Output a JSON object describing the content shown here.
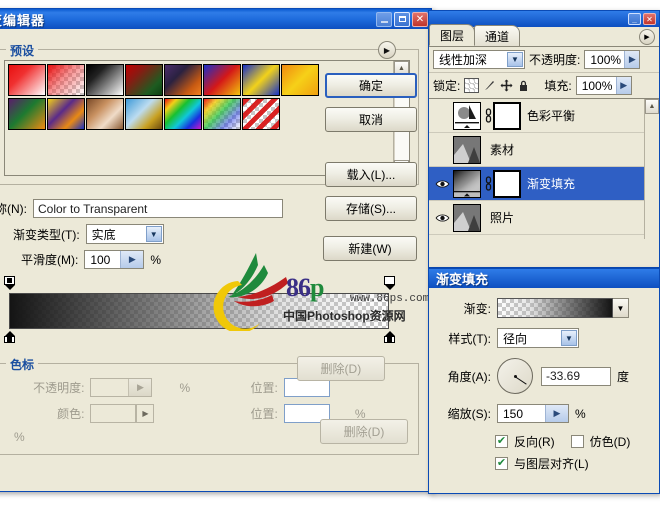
{
  "gradient_editor": {
    "title": "变编辑器",
    "window_buttons": {
      "minimize": "_",
      "maximize": "□",
      "close": "✕"
    },
    "presets_group_label": "预设",
    "presets_menu_icon": "play-arrow-icon",
    "buttons": {
      "ok": "确定",
      "cancel": "取消",
      "load": "载入(L)...",
      "save": "存储(S)...",
      "new": "新建(W)"
    },
    "name_label": "称(N):",
    "name_value": "Color to Transparent",
    "gradient_type_label": "渐变类型(T):",
    "gradient_type_value": "实底",
    "smoothness_label": "平滑度(M):",
    "smoothness_value": "100",
    "smoothness_unit": "%",
    "stops_group_label": "色标",
    "opacity_label": "不透明度:",
    "opacity_value": "",
    "opacity_unit": "%",
    "color_label": "颜色:",
    "location_label_1": "位置:",
    "location_value_1": "",
    "location_unit_1": "%",
    "location_label_2": "位置:",
    "location_value_2": "",
    "location_unit_2": "%",
    "delete_label_1": "删除(D)",
    "delete_label_2": "删除(D)"
  },
  "presets": [
    {
      "name": "foreground-to-background",
      "css": "linear-gradient(135deg,#e81010 0%,#f03030 35%,#ffffff 100%)"
    },
    {
      "name": "foreground-to-transparent",
      "css": "linear-gradient(135deg,rgba(232,16,16,1) 0%,rgba(240,60,60,.55) 45%,rgba(255,255,255,0) 100%)",
      "checker": true
    },
    {
      "name": "black-white",
      "css": "linear-gradient(135deg,#000000 0%,#222222 30%,#ffffff 100%)"
    },
    {
      "name": "red-green",
      "css": "linear-gradient(135deg,#c00000 0%,#8a1a12 30%,#1d5c20 75%,#0d3f12 100%)"
    },
    {
      "name": "violet-orange",
      "css": "linear-gradient(135deg,#4b2d6b 0%,#2a2140 35%,#c85a12 75%,#f08020 100%)"
    },
    {
      "name": "blue-red-yellow",
      "css": "linear-gradient(135deg,#1b2ec8 0%,#d41818 50%,#f2c40c 100%)"
    },
    {
      "name": "blue-yellow-blue",
      "css": "linear-gradient(135deg,#1630c8 0%,#f2d21a 50%,#1630c8 100%)"
    },
    {
      "name": "orange-yellow-orange",
      "css": "linear-gradient(135deg,#f08a10 0%,#f6d018 50%,#f0a010 100%)"
    },
    {
      "name": "violet-green-orange",
      "css": "linear-gradient(135deg,#5a1d6b 0%,#1d7a30 45%,#f08a12 100%)"
    },
    {
      "name": "yellow-violet-orange-blue",
      "css": "linear-gradient(135deg,#f2cf18 0%,#5a2a8a 40%,#e88a14 70%,#1830c0 100%)"
    },
    {
      "name": "copper",
      "css": "linear-gradient(135deg,#7a4a28 0%,#c89060 35%,#f0dcc8 65%,#8a5a32 100%)"
    },
    {
      "name": "chrome",
      "css": "linear-gradient(135deg,#3e9ad8 0%,#bcdcf0 42%,#c8a020 72%,#6a4a10 100%)"
    },
    {
      "name": "spectrum",
      "css": "linear-gradient(135deg,#e81010 0%,#f2d018 18%,#18c030 38%,#10c8d8 58%,#1830e0 78%,#d018c8 100%)"
    },
    {
      "name": "transparent-rainbow",
      "css": "linear-gradient(135deg,rgba(232,16,16,.95) 0%,rgba(242,208,24,.85) 22%,rgba(24,192,48,.7) 45%,rgba(24,48,224,.5) 72%,rgba(208,24,200,0) 100%)",
      "checker": true
    },
    {
      "name": "transparent-stripes",
      "css": "repeating-linear-gradient(135deg,rgba(216,24,24,.95) 0 5px,rgba(255,255,255,0) 5px 10px)",
      "checker": true
    }
  ],
  "gradient_strip": {
    "stops": [
      {
        "name": "opacity-stop-left",
        "side": "top",
        "pos": 0,
        "filled": true
      },
      {
        "name": "opacity-stop-right",
        "side": "top",
        "pos": 100,
        "filled": false
      },
      {
        "name": "color-stop-left",
        "side": "bottom",
        "pos": 0,
        "filled": true
      },
      {
        "name": "color-stop-right",
        "side": "bottom",
        "pos": 100,
        "filled": true
      }
    ]
  },
  "watermark": {
    "brand_86": "86",
    "brand_p": "p",
    "brand_s": "s",
    "url": "www.86ps.com",
    "subtitle": "中国Photoshop资源网"
  },
  "layers_panel": {
    "tabs": [
      {
        "label": "图层",
        "active": true
      },
      {
        "label": "通道",
        "active": false
      }
    ],
    "blend_mode": "线性加深",
    "opacity_label": "不透明度:",
    "opacity_value": "100%",
    "lock_label": "锁定:",
    "lock_icons": [
      "transparency-lock-icon",
      "brush-lock-icon",
      "move-lock-icon",
      "all-lock-icon"
    ],
    "fill_label": "填充:",
    "fill_value": "100%",
    "layers": [
      {
        "name": "色彩平衡",
        "visible": false,
        "selected": false,
        "has_mask": true,
        "type": "adjustment"
      },
      {
        "name": "素材",
        "visible": false,
        "selected": false,
        "has_mask": false,
        "type": "image"
      },
      {
        "name": "渐变填充",
        "visible": true,
        "selected": true,
        "has_mask": true,
        "type": "fill"
      },
      {
        "name": "照片",
        "visible": true,
        "selected": false,
        "has_mask": false,
        "type": "image"
      }
    ]
  },
  "gradient_fill": {
    "title": "渐变填充",
    "gradient_label": "渐变:",
    "style_label": "样式(T):",
    "style_value": "径向",
    "angle_label": "角度(A):",
    "angle_value": "-33.69",
    "angle_unit": "度",
    "scale_label": "缩放(S):",
    "scale_value": "150",
    "scale_unit": "%",
    "reverse_label": "反向(R)",
    "reverse_checked": true,
    "dither_label": "仿色(D)",
    "dither_checked": false,
    "align_label": "与图层对齐(L)",
    "align_checked": true,
    "check_glyph": "✔"
  }
}
